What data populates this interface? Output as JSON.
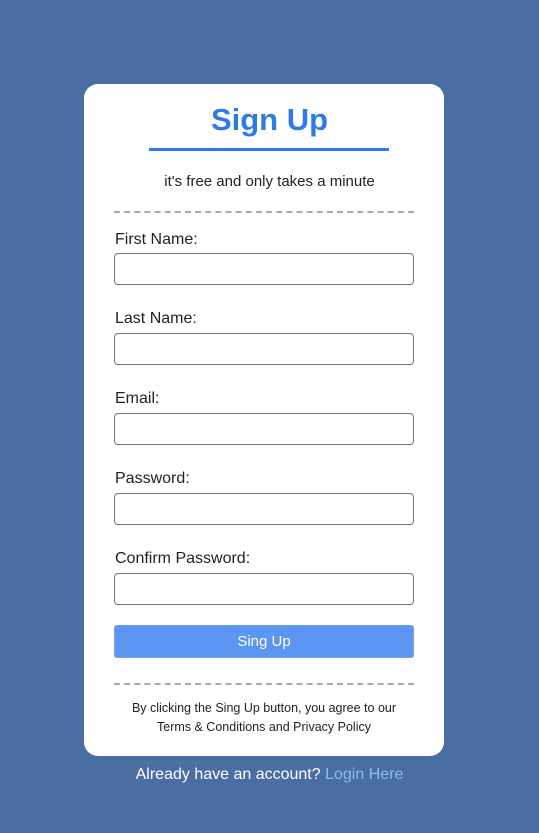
{
  "form": {
    "title": "Sign Up",
    "subtitle": "it's free and only takes a minute",
    "fields": [
      {
        "label": "First Name:",
        "value": ""
      },
      {
        "label": "Last Name:",
        "value": ""
      },
      {
        "label": "Email:",
        "value": ""
      },
      {
        "label": "Password:",
        "value": ""
      },
      {
        "label": "Confirm Password:",
        "value": ""
      }
    ],
    "submit_label": "Sing Up",
    "terms_text": "By clicking the Sing Up button, you agree to our Terms & Conditions and Privacy Policy"
  },
  "footer": {
    "prompt_text": "Already have an account?",
    "login_link": "Login Here"
  },
  "colors": {
    "background": "#4a6ea2",
    "accent": "#2f7be6",
    "button": "#5b97f2",
    "link": "#8cb8f5"
  }
}
